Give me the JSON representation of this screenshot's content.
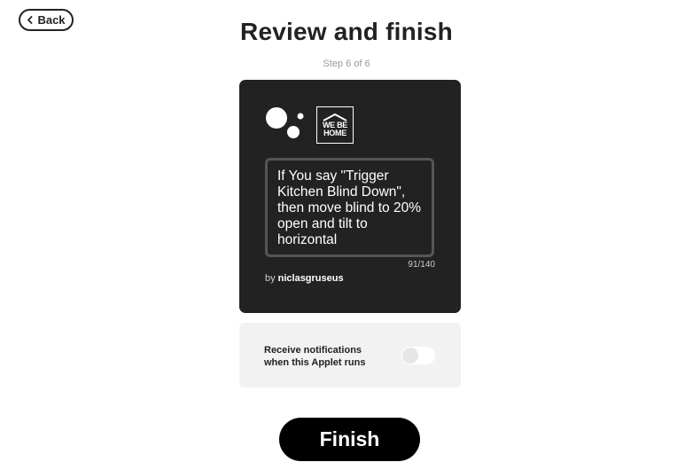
{
  "header": {
    "back_label": "Back",
    "title": "Review and finish",
    "step": "Step 6 of 6"
  },
  "applet": {
    "trigger_service_icon": "google-assistant-icon",
    "action_service_icon": "we-be-home-logo",
    "action_logo_text": "WE BE HOME",
    "description": "If You say \"Trigger Kitchen Blind Down\", then move blind to 20% open and tilt to horizontal",
    "char_count": "91/140",
    "by_label": "by",
    "author": "niclasgruseus",
    "card_color": "#222222"
  },
  "notifications": {
    "label": "Receive notifications when this Applet runs",
    "enabled": false
  },
  "footer": {
    "finish_label": "Finish"
  }
}
